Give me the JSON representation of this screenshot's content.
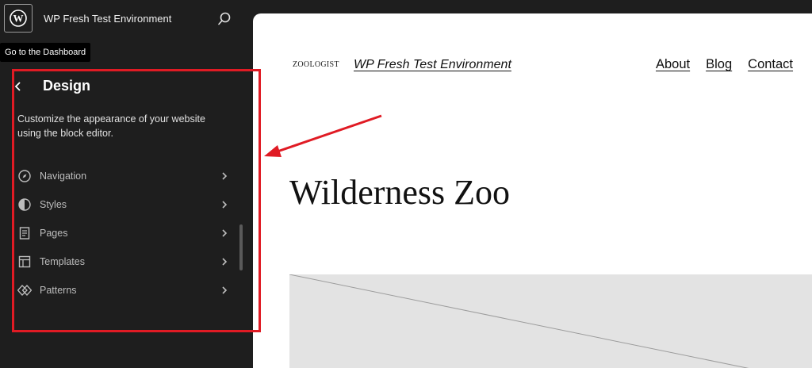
{
  "topbar": {
    "site_title": "WP Fresh Test Environment"
  },
  "tooltip": {
    "text": "Go to the Dashboard"
  },
  "panel": {
    "title": "Design",
    "description": "Customize the appearance of your website using the block editor.",
    "items": [
      {
        "label": "Navigation",
        "icon": "compass-icon"
      },
      {
        "label": "Styles",
        "icon": "half-circle-icon"
      },
      {
        "label": "Pages",
        "icon": "page-icon"
      },
      {
        "label": "Templates",
        "icon": "layout-icon"
      },
      {
        "label": "Patterns",
        "icon": "diamond-icon"
      }
    ]
  },
  "preview": {
    "logo_text": "ZOOLOGIST",
    "site_title": "WP Fresh Test Environment",
    "nav": [
      "About",
      "Blog",
      "Contact"
    ],
    "headline": "Wilderness Zoo"
  },
  "annotation": {
    "color": "#e01b24"
  }
}
